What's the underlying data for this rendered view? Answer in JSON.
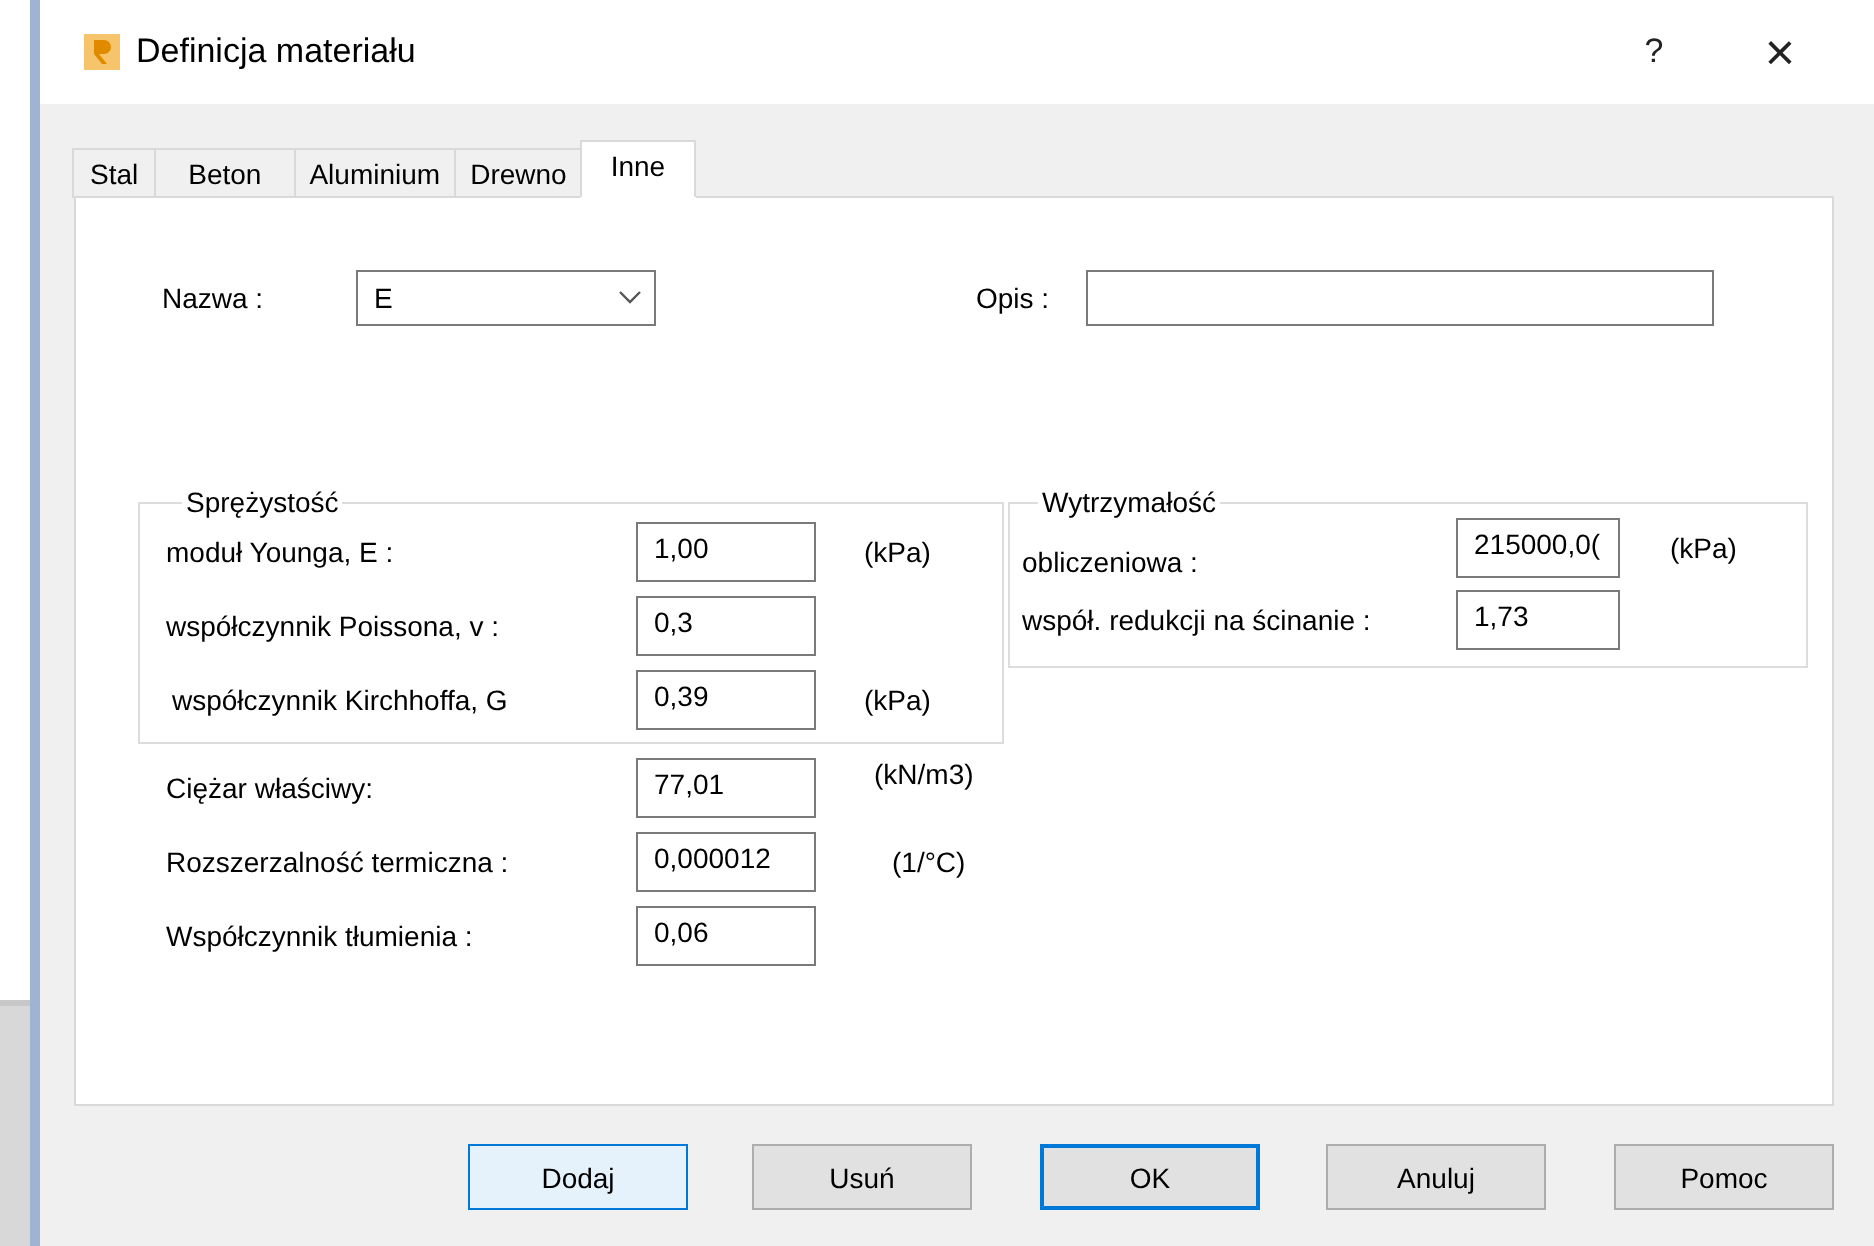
{
  "window": {
    "title": "Definicja materiału",
    "help": "?",
    "close": "×"
  },
  "tabs": [
    {
      "label": "Stal",
      "selected": false
    },
    {
      "label": "Beton",
      "selected": false
    },
    {
      "label": "Aluminium",
      "selected": false
    },
    {
      "label": "Drewno",
      "selected": false
    },
    {
      "label": "Inne",
      "selected": true
    }
  ],
  "name": {
    "label": "Nazwa :",
    "value": "E"
  },
  "description": {
    "label": "Opis :"
  },
  "elasticity": {
    "title": "Sprężystość",
    "rows": [
      {
        "label": "moduł Younga, E :",
        "value": "1,00",
        "unit": "(kPa)"
      },
      {
        "label": "współczynnik Poissona, v :",
        "value": "0,3"
      },
      {
        "label": "współczynnik Kirchhoffa, G",
        "value": "0,39",
        "unit": "(kPa)"
      }
    ]
  },
  "properties": [
    {
      "label": "Ciężar właściwy:",
      "value": "77,01",
      "unit": "(kN/m3)"
    },
    {
      "label": "Rozszerzalność termiczna :",
      "value": "0,000012",
      "unit": "(1/°C)"
    },
    {
      "label": "Współczynnik tłumienia :",
      "value": "0,06"
    }
  ],
  "strength": {
    "title": "Wytrzymałość",
    "rows": [
      {
        "label": "obliczeniowa :",
        "value": "215000,0(",
        "unit": "(kPa)"
      },
      {
        "label": "współ. redukcji na ścinanie :",
        "value": "1,73"
      }
    ]
  },
  "buttons": [
    {
      "label": "Dodaj",
      "kind": "hovered"
    },
    {
      "label": "Usuń",
      "kind": "normal"
    },
    {
      "label": "OK",
      "kind": "default"
    },
    {
      "label": "Anuluj",
      "kind": "normal"
    },
    {
      "label": "Pomoc",
      "kind": "normal"
    }
  ]
}
